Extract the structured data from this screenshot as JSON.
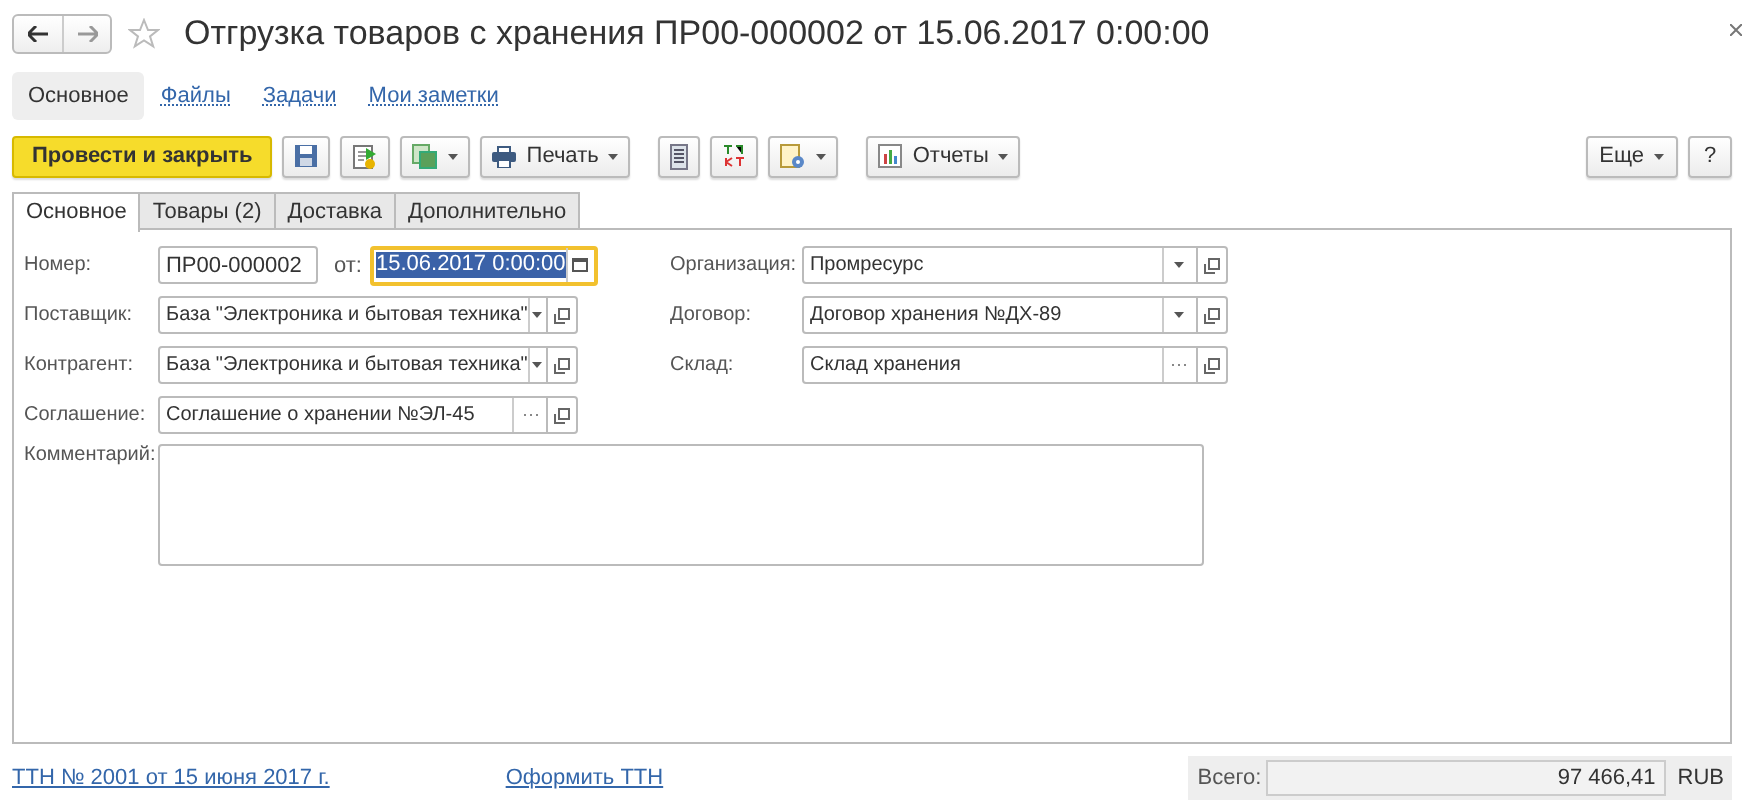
{
  "window": {
    "title": "Отгрузка товаров с хранения ПР00-000002 от 15.06.2017 0:00:00"
  },
  "nav_tabs": [
    {
      "label": "Основное",
      "selected": true
    },
    {
      "label": "Файлы",
      "selected": false
    },
    {
      "label": "Задачи",
      "selected": false
    },
    {
      "label": "Мои заметки",
      "selected": false
    }
  ],
  "toolbar": {
    "primary": "Провести и закрыть",
    "print": "Печать",
    "reports": "Отчеты",
    "more": "Еще",
    "help": "?"
  },
  "form_tabs": [
    {
      "label": "Основное",
      "selected": true
    },
    {
      "label": "Товары (2)",
      "selected": false
    },
    {
      "label": "Доставка",
      "selected": false
    },
    {
      "label": "Дополнительно",
      "selected": false
    }
  ],
  "number": {
    "label": "Номер:",
    "value": "ПР00-000002"
  },
  "date": {
    "label": "от:",
    "value": "15.06.2017  0:00:00",
    "focused": true
  },
  "fields_left": [
    {
      "label": "Поставщик:",
      "value": "База \"Электроника и бытовая техника\"",
      "kind": "select"
    },
    {
      "label": "Контрагент:",
      "value": "База \"Электроника и бытовая техника\"",
      "kind": "select"
    },
    {
      "label": "Соглашение:",
      "value": "Соглашение о хранении №ЭЛ-45",
      "kind": "choice"
    }
  ],
  "fields_right": [
    {
      "label": "Организация:",
      "value": "Промресурс",
      "kind": "select"
    },
    {
      "label": "Договор:",
      "value": "Договор хранения №ДХ-89",
      "kind": "select"
    },
    {
      "label": "Склад:",
      "value": "Склад хранения",
      "kind": "choice"
    }
  ],
  "comment": {
    "label": "Комментарий:"
  },
  "footer": {
    "links": [
      "ТТН  № 2001 от 15 июня 2017 г.",
      "Оформить ТТН"
    ],
    "total_label": "Всего:",
    "total": "97 466,41",
    "currency": "RUB"
  }
}
